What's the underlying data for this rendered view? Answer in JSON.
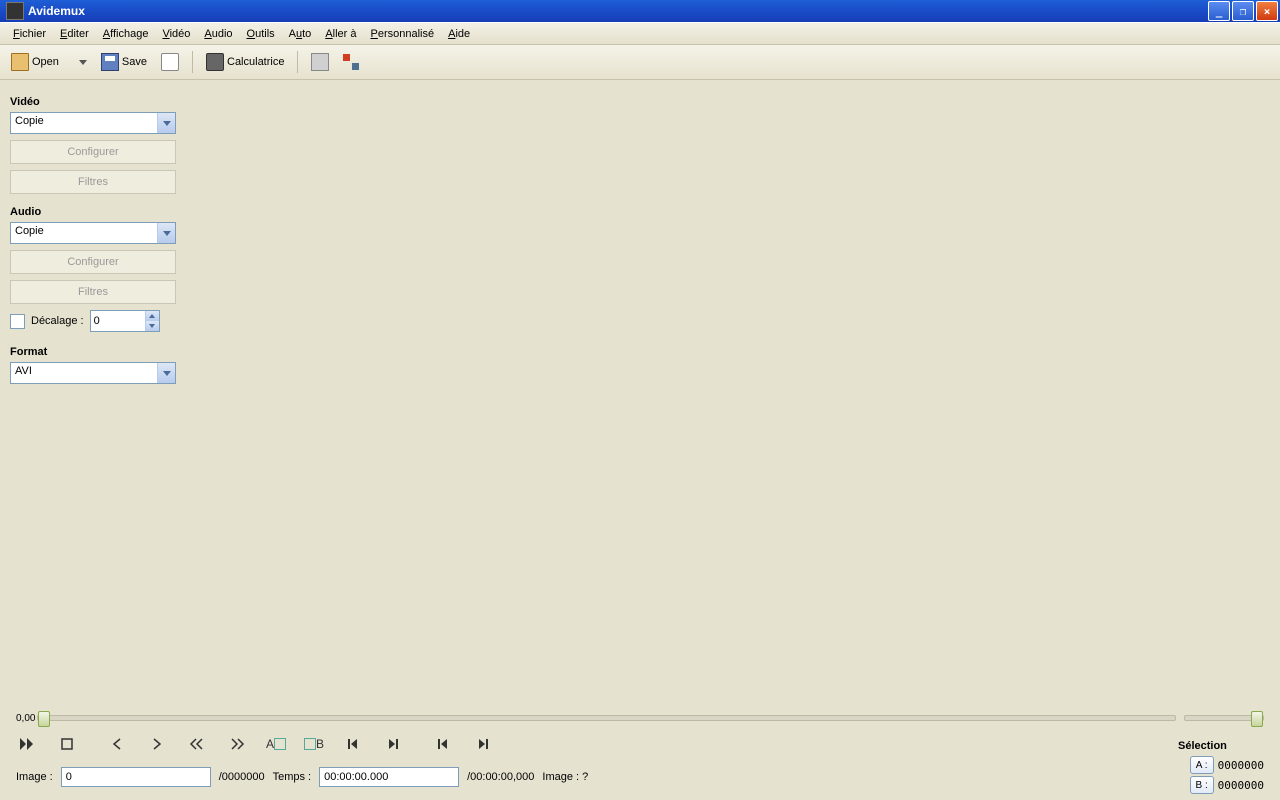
{
  "title": "Avidemux",
  "menu": {
    "items": [
      "Fichier",
      "Editer",
      "Affichage",
      "Vidéo",
      "Audio",
      "Outils",
      "Auto",
      "Aller à",
      "Personnalisé",
      "Aide"
    ]
  },
  "toolbar": {
    "open_label": "Open",
    "save_label": "Save",
    "calc_label": "Calculatrice"
  },
  "sidebar": {
    "video_label": "Vidéo",
    "video_codec": "Copie",
    "configure_label": "Configurer",
    "filters_label": "Filtres",
    "audio_label": "Audio",
    "audio_codec": "Copie",
    "decalage_label": "Décalage :",
    "decalage_value": "0",
    "format_label": "Format",
    "format_value": "AVI"
  },
  "slider": {
    "position": "0,00"
  },
  "selection": {
    "title": "Sélection",
    "a_label": "A :",
    "a_value": "0000000",
    "b_label": "B :",
    "b_value": "0000000"
  },
  "status": {
    "image_label": "Image :",
    "image_value": "0",
    "image_total": "/0000000",
    "time_label": "Temps :",
    "time_value": "00:00:00.000",
    "time_total": "/00:00:00,000",
    "image_q": "Image :  ?"
  }
}
